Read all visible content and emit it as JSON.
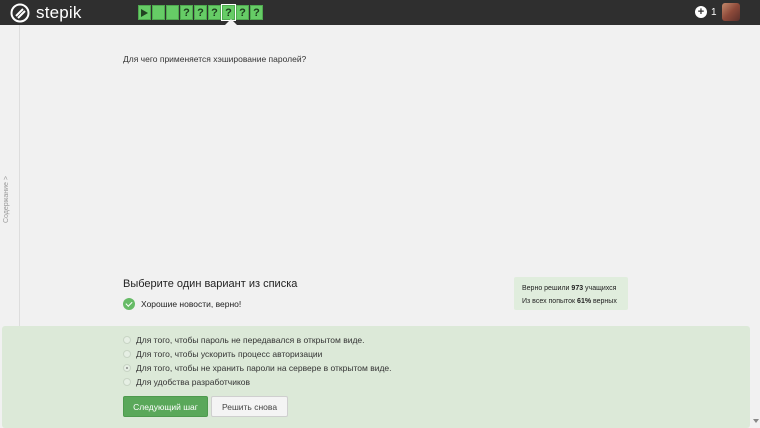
{
  "app": {
    "name": "stepik"
  },
  "steps": [
    "",
    "",
    "",
    "?",
    "?",
    "?",
    "?",
    "?",
    "?"
  ],
  "points": {
    "value": "1"
  },
  "sidebar": {
    "label": "Содержание >"
  },
  "question": {
    "text": "Для чего применяется хэширование паролей?"
  },
  "quiz": {
    "heading": "Выберите один вариант из списка",
    "feedback": "Хорошие новости, верно!",
    "stats": {
      "line1_prefix": "Верно решили ",
      "line1_value": "973",
      "line1_suffix": " учащихся",
      "line2_prefix": "Из всех попыток ",
      "line2_value": "61%",
      "line2_suffix": " верных"
    },
    "options": [
      {
        "label": "Для того, чтобы пароль не передавался в открытом виде.",
        "selected": false
      },
      {
        "label": "Для того, чтобы ускорить процесс авторизации",
        "selected": false
      },
      {
        "label": "Для того, чтобы не хранить пароли на сервере в открытом виде.",
        "selected": true
      },
      {
        "label": "Для удобства разработчиков",
        "selected": false
      }
    ],
    "next_label": "Следующий шаг",
    "retry_label": "Решить снова"
  },
  "colors": {
    "topbar": "#2f2f2f",
    "success": "#5aa85a",
    "panel": "#dce9d8"
  }
}
